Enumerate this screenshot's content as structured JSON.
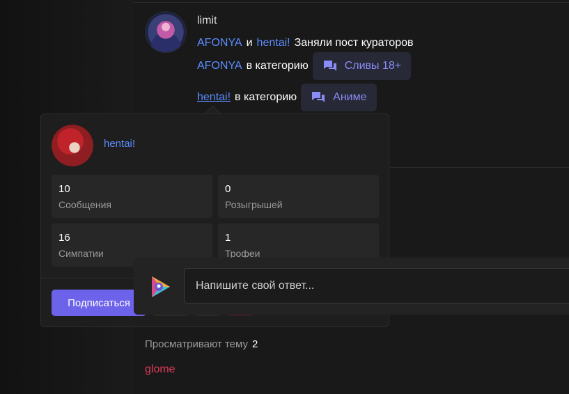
{
  "message": {
    "author": "limit",
    "line1": {
      "user1": "AFONYA",
      "and": "и",
      "user2": "hentai!",
      "text": "Заняли пост кураторов"
    },
    "line2": {
      "user": "AFONYA",
      "text": "в категорию",
      "category": "Сливы 18+"
    },
    "line3": {
      "user": "hentai!",
      "text": "в категорию",
      "category": "Аниме"
    },
    "icon": "chat-bubbles-icon"
  },
  "popup": {
    "username": "hentai!",
    "stats": [
      {
        "value": "10",
        "label": "Сообщения"
      },
      {
        "value": "0",
        "label": "Розыгрышей"
      },
      {
        "value": "16",
        "label": "Симпатии"
      },
      {
        "value": "1",
        "label": "Трофеи"
      }
    ],
    "subscribe_label": "Подписаться"
  },
  "reply": {
    "placeholder": "Напишите свой ответ..."
  },
  "watching": {
    "label": "Просматривают тему",
    "count": "2"
  },
  "viewers": [
    "glome"
  ],
  "colors": {
    "accent": "#6c63ea",
    "link": "#5b8dff",
    "category_text": "#8a8cf7",
    "viewer_name": "#e03b5a"
  }
}
